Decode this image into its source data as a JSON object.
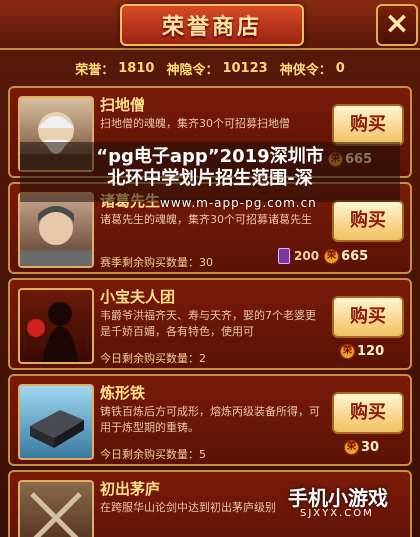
{
  "window": {
    "title": "荣誉商店",
    "close_label": "×"
  },
  "currencies": [
    {
      "label": "荣誉：",
      "value": "1810"
    },
    {
      "label": "神隐令：",
      "value": "10123"
    },
    {
      "label": "神侠令：",
      "value": "0"
    }
  ],
  "items": [
    {
      "name": "扫地僧",
      "desc": "扫地僧的魂魄，集齐30个可招募扫地僧",
      "limit": "",
      "buy_label": "购买",
      "old_price": "",
      "price": "665"
    },
    {
      "name": "诸葛先生",
      "desc": "诸葛先生的魂魄，集齐30个可招募诸葛先生",
      "limit": "赛季剩余购买数量：30",
      "buy_label": "购买",
      "old_price": "200",
      "price": "665"
    },
    {
      "name": "小宝夫人团",
      "desc": "韦爵爷洪福齐天、寿与天齐，娶的7个老婆更是千娇百媚，各有特色，使用可",
      "limit": "今日剩余购买数量：2",
      "buy_label": "购买",
      "old_price": "",
      "price": "120"
    },
    {
      "name": "炼形铁",
      "desc": "铸铁百炼后方可成形，熔炼丙级装备所得，可用于炼型期的重铸。",
      "limit": "今日剩余购买数量：5",
      "buy_label": "购买",
      "old_price": "",
      "price": "30"
    },
    {
      "name": "初出茅庐",
      "desc": "在跨服华山论剑中达到初出茅庐级别",
      "limit": "",
      "buy_label": "",
      "old_price": "",
      "price": ""
    }
  ],
  "coin_glyph": "荣",
  "watermark": {
    "line1": "“pg电子app”2019深圳市",
    "line2": "北环中学划片招生范围-深",
    "url": "www.m-app-pg.com.cn"
  },
  "brand": {
    "name": "手机小游戏",
    "url": "SJXYX.COM"
  }
}
